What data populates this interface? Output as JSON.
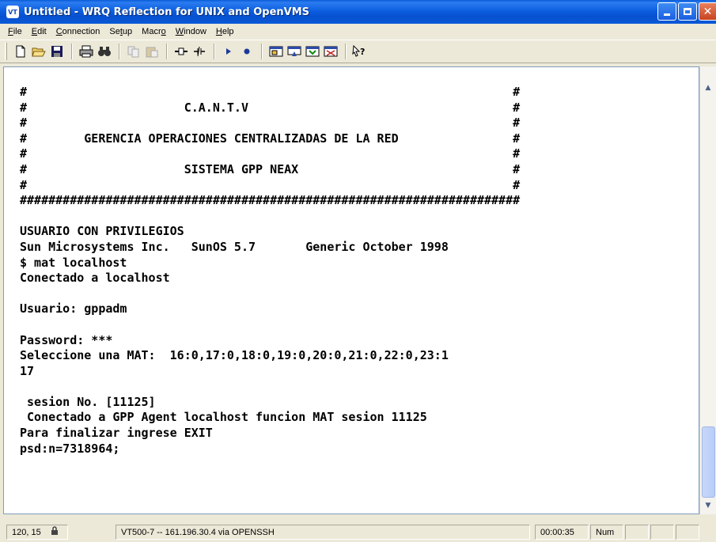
{
  "window": {
    "title": "Untitled - WRQ Reflection for UNIX and OpenVMS",
    "app_icon_text": "VT"
  },
  "menu": {
    "items": [
      {
        "label": "File",
        "access": "F"
      },
      {
        "label": "Edit",
        "access": "E"
      },
      {
        "label": "Connection",
        "access": "C"
      },
      {
        "label": "Setup",
        "access": "t"
      },
      {
        "label": "Macro",
        "access": "o"
      },
      {
        "label": "Window",
        "access": "W"
      },
      {
        "label": "Help",
        "access": "H"
      }
    ]
  },
  "toolbar": {
    "buttons": [
      "new-document-icon",
      "open-folder-icon",
      "save-disk-icon",
      "print-icon",
      "find-binoculars-icon",
      "copy-icon",
      "paste-icon",
      "connect-plug-icon",
      "disconnect-icon",
      "play-macro-icon",
      "record-macro-icon",
      "setup-dialog-icon",
      "keyboard-map-icon",
      "display-settings-icon",
      "terminal-type-icon",
      "context-help-icon"
    ]
  },
  "terminal": {
    "lines": [
      "#                                                                    #",
      "#                      C.A.N.T.V                                     #",
      "#                                                                    #",
      "#        GERENCIA OPERACIONES CENTRALIZADAS DE LA RED                #",
      "#                                                                    #",
      "#                      SISTEMA GPP NEAX                              #",
      "#                                                                    #",
      "######################################################################",
      "",
      "USUARIO CON PRIVILEGIOS",
      "Sun Microsystems Inc.   SunOS 5.7       Generic October 1998",
      "$ mat localhost",
      "Conectado a localhost",
      "",
      "Usuario: gppadm",
      "",
      "Password: ***",
      "Seleccione una MAT:  16:0,17:0,18:0,19:0,20:0,21:0,22:0,23:1",
      "17",
      "",
      " sesion No. [11125]",
      " Conectado a GPP Agent localhost funcion MAT sesion 11125",
      "Para finalizar ingrese EXIT",
      "psd:n=7318964;"
    ]
  },
  "status": {
    "cursor_pos": "120, 15",
    "lock_icon": "padlock-icon",
    "connection": "VT500-7 -- 161.196.30.4 via OPENSSH",
    "elapsed": "00:00:35",
    "num_lock": "Num"
  }
}
